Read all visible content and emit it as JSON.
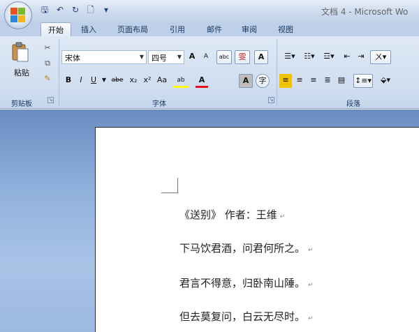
{
  "window": {
    "title": "文档 4 - Microsoft Wo"
  },
  "qat": {
    "save": "🖫",
    "undo": "↶",
    "redo": "↻",
    "new": "🗋",
    "more": "▾"
  },
  "tabs": [
    "开始",
    "插入",
    "页面布局",
    "引用",
    "邮件",
    "审阅",
    "视图"
  ],
  "groups": {
    "clipboard": {
      "label": "剪贴板",
      "paste": "粘贴"
    },
    "font": {
      "label": "字体",
      "font_name": "宋体",
      "font_size": "四号",
      "grow": "A",
      "shrink": "A",
      "phonetic": "abc",
      "clear": "雯",
      "border": "A",
      "bold": "B",
      "italic": "I",
      "underline": "U",
      "strike": "abe",
      "sub": "x₂",
      "sup": "x²",
      "case": "Aa",
      "highlight": "ab",
      "color": "A",
      "shade": "A",
      "circle": "字"
    },
    "paragraph": {
      "label": "段落"
    }
  },
  "colors": {
    "accent": "#f2c300",
    "font_color": "#e81123",
    "highlight": "#ffff00"
  },
  "document": {
    "lines": [
      "《送别》 作者：王维",
      "下马饮君酒，问君何所之。",
      "君言不得意，归卧南山陲。",
      "但去莫复问，白云无尽时。"
    ],
    "mark": "↵"
  }
}
